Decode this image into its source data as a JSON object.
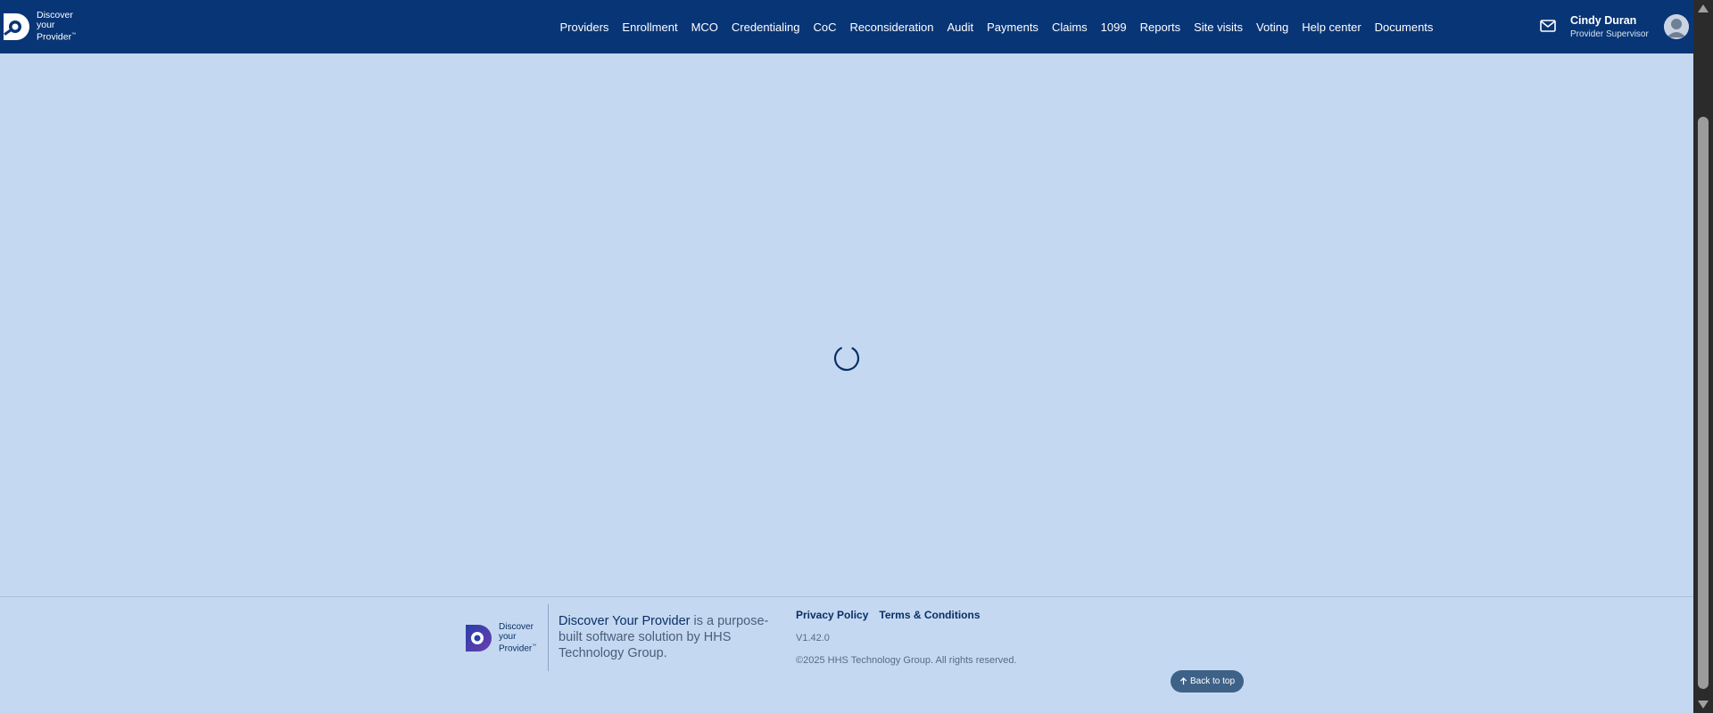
{
  "header": {
    "brand": {
      "line1": "Discover",
      "line2": "your",
      "line3": "Provider",
      "icon": "discover-provider-logo"
    },
    "nav": [
      {
        "label": "Providers"
      },
      {
        "label": "Enrollment"
      },
      {
        "label": "MCO"
      },
      {
        "label": "Credentialing"
      },
      {
        "label": "CoC"
      },
      {
        "label": "Reconsideration"
      },
      {
        "label": "Audit"
      },
      {
        "label": "Payments"
      },
      {
        "label": "Claims"
      },
      {
        "label": "1099"
      },
      {
        "label": "Reports"
      },
      {
        "label": "Site visits"
      },
      {
        "label": "Voting"
      },
      {
        "label": "Help center"
      },
      {
        "label": "Documents"
      }
    ],
    "mail_icon": "mail-icon",
    "user": {
      "name": "Cindy Duran",
      "role": "Provider Supervisor",
      "avatar_icon": "user-avatar-icon"
    }
  },
  "main": {
    "loading_icon": "loading-spinner-icon"
  },
  "footer": {
    "brand": {
      "line1": "Discover",
      "line2": "your",
      "line3": "Provider"
    },
    "tagline_strong": "Discover Your Provider",
    "tagline_rest": " is a purpose-built software solution by HHS Technology Group.",
    "links": {
      "privacy": "Privacy Policy",
      "terms": "Terms & Conditions"
    },
    "version": "V1.42.0",
    "copyright": "©2025 HHS Technology Group. All rights reserved.",
    "back_to_top": "Back to top"
  },
  "colors": {
    "header_bg": "#083576",
    "page_bg": "#c4d9f1",
    "accent_dark": "#0a2f66",
    "back_top_bg": "#3e6287"
  }
}
